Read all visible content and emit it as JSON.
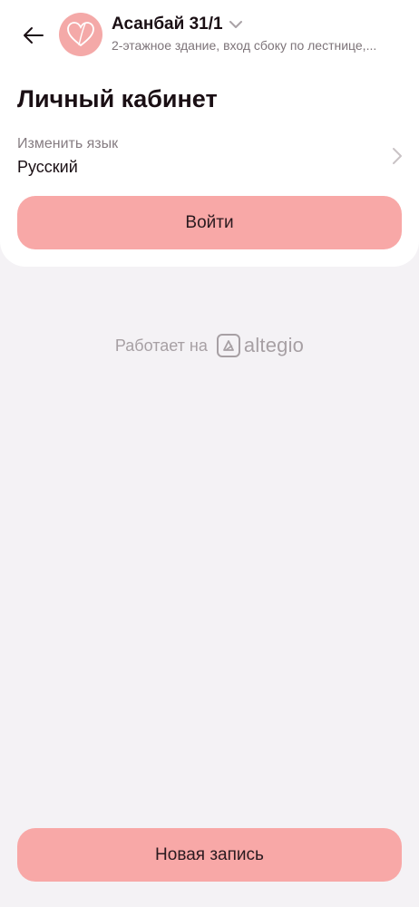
{
  "header": {
    "back_icon": "arrow-left-icon",
    "avatar_icon": "heart-logo-icon",
    "branch_title": "Асанбай 31/1",
    "branch_chevron_icon": "chevron-down-icon",
    "branch_subtitle": "2-этажное здание, вход сбоку по лестнице,..."
  },
  "account": {
    "title": "Личный кабинет",
    "language_label": "Изменить язык",
    "language_value": "Русский",
    "language_chevron_icon": "chevron-right-icon",
    "login_label": "Войти"
  },
  "footer": {
    "powered_text": "Работает на",
    "brand": "altegio",
    "new_booking_label": "Новая запись"
  },
  "colors": {
    "accent": "#f8a8a7",
    "avatar": "#f4a9a8",
    "background": "#f4f2f5",
    "card": "#ffffff",
    "text_primary": "#1a0f14",
    "text_secondary": "#7d7479",
    "muted": "#a7a0a4"
  }
}
